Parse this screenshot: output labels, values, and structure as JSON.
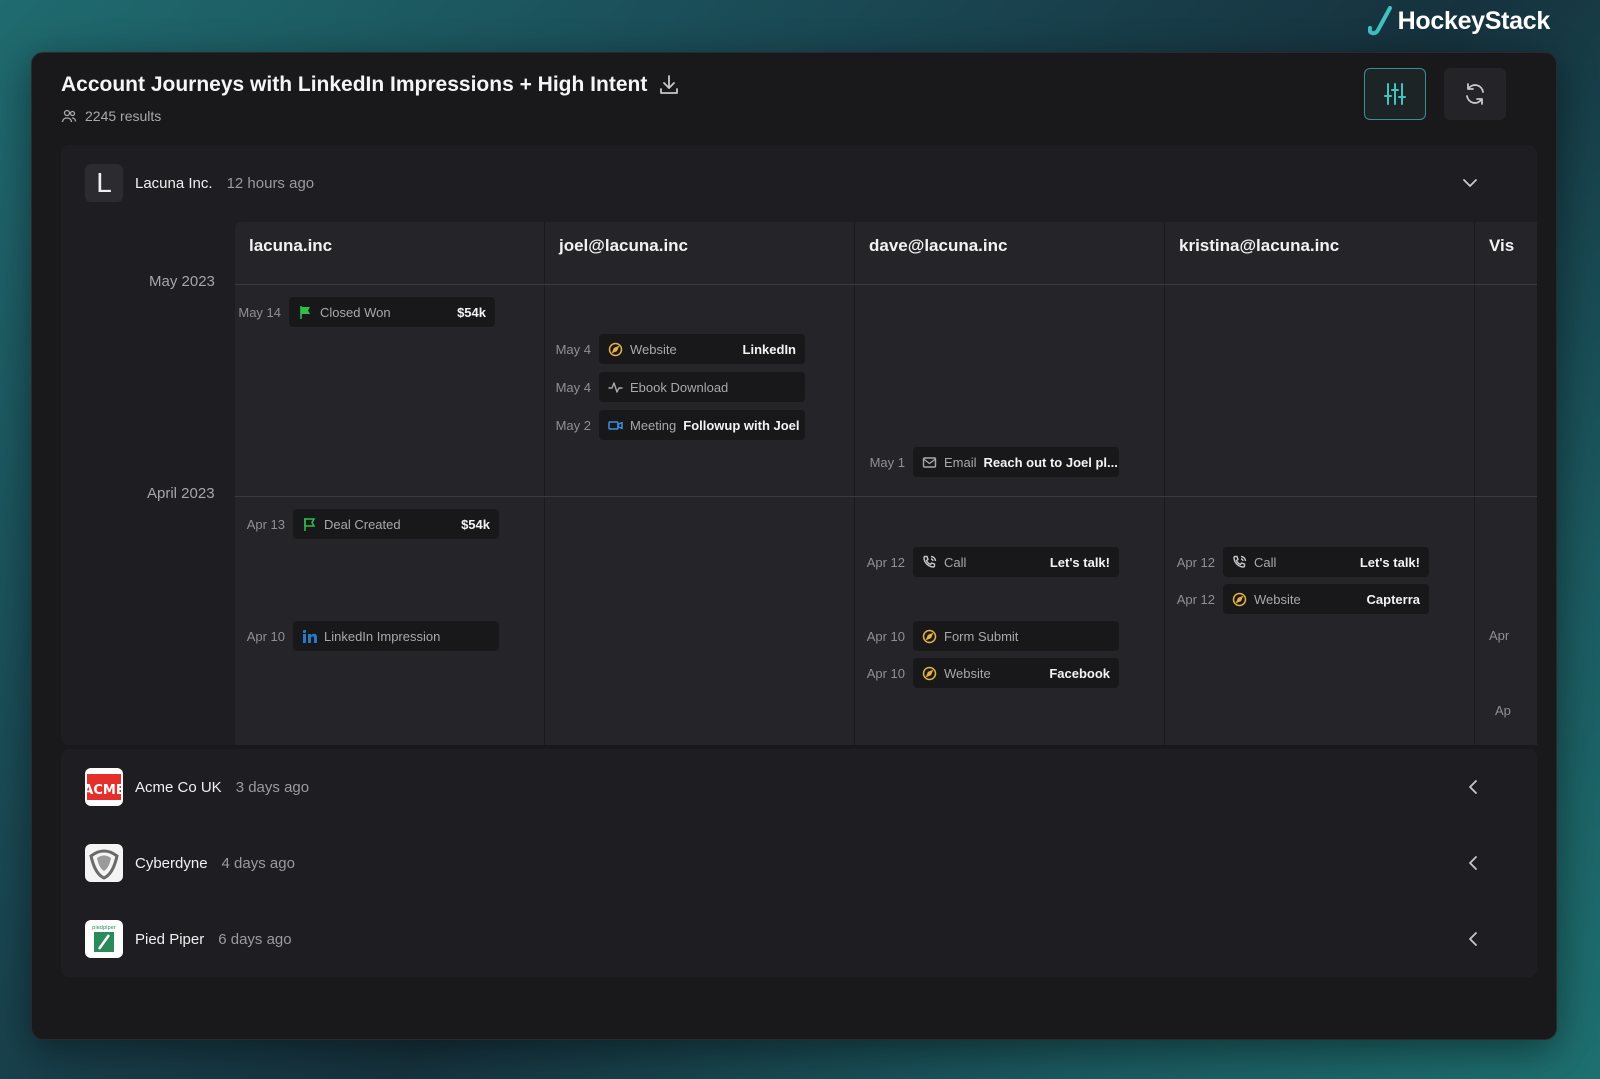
{
  "brand": {
    "name": "HockeyStack"
  },
  "header": {
    "title": "Account Journeys with LinkedIn Impressions + High Intent",
    "results": "2245 results"
  },
  "expanded_account": {
    "logo_letter": "L",
    "name": "Lacuna Inc.",
    "time": "12 hours ago",
    "months": [
      "May 2023",
      "April 2023"
    ],
    "columns": [
      "lacuna.inc",
      "joel@lacuna.inc",
      "dave@lacuna.inc",
      "kristina@lacuna.inc",
      "Vis"
    ],
    "events": [
      {
        "col": 0,
        "date": "May 14",
        "type": "Closed Won",
        "value": "$54k",
        "icon": "flag-filled-icon"
      },
      {
        "col": 1,
        "date": "May 4",
        "type": "Website",
        "value": "LinkedIn",
        "icon": "compass-icon"
      },
      {
        "col": 1,
        "date": "May 4",
        "type": "Ebook Download",
        "value": "",
        "icon": "activity-icon"
      },
      {
        "col": 1,
        "date": "May 2",
        "type": "Meeting",
        "value": "Followup with Joel",
        "icon": "video-icon"
      },
      {
        "col": 2,
        "date": "May 1",
        "type": "Email",
        "value": "Reach out to Joel pl...",
        "icon": "mail-icon"
      },
      {
        "col": 0,
        "date": "Apr 13",
        "type": "Deal Created",
        "value": "$54k",
        "icon": "flag-outline-icon"
      },
      {
        "col": 0,
        "date": "Apr 10",
        "type": "LinkedIn Impression",
        "value": "",
        "icon": "linkedin-icon"
      },
      {
        "col": 2,
        "date": "Apr 12",
        "type": "Call",
        "value": "Let's talk!",
        "icon": "phone-icon"
      },
      {
        "col": 2,
        "date": "Apr 10",
        "type": "Form Submit",
        "value": "",
        "icon": "compass-icon"
      },
      {
        "col": 2,
        "date": "Apr 10",
        "type": "Website",
        "value": "Facebook",
        "icon": "compass-icon"
      },
      {
        "col": 3,
        "date": "Apr 12",
        "type": "Call",
        "value": "Let's talk!",
        "icon": "phone-icon"
      },
      {
        "col": 3,
        "date": "Apr 12",
        "type": "Website",
        "value": "Capterra",
        "icon": "compass-icon"
      }
    ],
    "partial_dates": [
      "Apr",
      "Ap"
    ]
  },
  "accounts": [
    {
      "name": "Acme Co UK",
      "time": "3 days ago",
      "logo": "acme-logo"
    },
    {
      "name": "Cyberdyne",
      "time": "4 days ago",
      "logo": "cyberdyne-logo"
    },
    {
      "name": "Pied Piper",
      "time": "6 days ago",
      "logo": "pied-piper-logo",
      "logo_caption": "piedpiper"
    }
  ],
  "colors": {
    "accent": "#3fc3c3",
    "flag_green": "#2fbf4a",
    "compass_yellow": "#e3b341",
    "video_blue": "#3d8fe0",
    "linkedin_blue": "#2a78c2",
    "acme_red": "#e4302b"
  }
}
